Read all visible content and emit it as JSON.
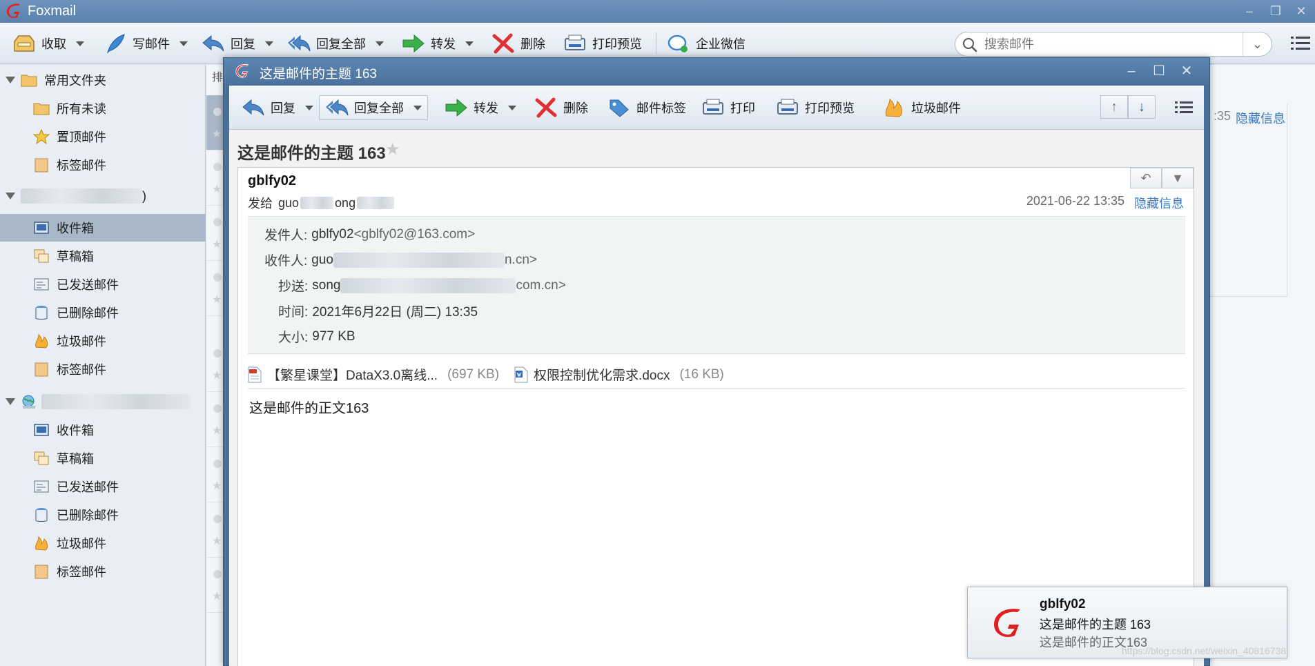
{
  "app": {
    "title": "Foxmail"
  },
  "toolbar": {
    "receive": "收取",
    "compose": "写邮件",
    "reply": "回复",
    "reply_all": "回复全部",
    "forward": "转发",
    "delete": "删除",
    "print_preview": "打印预览",
    "wecom": "企业微信",
    "search_placeholder": "搜索邮件"
  },
  "sidebar": {
    "common_folders": "常用文件夹",
    "common_items": [
      "所有未读",
      "置顶邮件",
      "标签邮件"
    ],
    "account1_suffix": ")",
    "account1_items": [
      "收件箱",
      "草稿箱",
      "已发送邮件",
      "已删除邮件",
      "垃圾邮件",
      "标签邮件"
    ],
    "account2_items": [
      "收件箱",
      "草稿箱",
      "已发送邮件",
      "已删除邮件",
      "垃圾邮件",
      "标签邮件"
    ]
  },
  "maillist": {
    "sort_label": "排"
  },
  "rightpane": {
    "time_fragment": ":35",
    "hide_info": "隐藏信息"
  },
  "message_window": {
    "title": "这是邮件的主题 163",
    "toolbar": {
      "reply": "回复",
      "reply_all": "回复全部",
      "forward": "转发",
      "delete": "删除",
      "tag": "邮件标签",
      "print": "打印",
      "print_preview": "打印预览",
      "junk": "垃圾邮件"
    },
    "subject": "这是邮件的主题 163",
    "sender": "gblfy02",
    "send_to_label": "发给",
    "send_to_a": "guo",
    "send_to_b": "ong",
    "datetime": "2021-06-22 13:35",
    "hide_info": "隐藏信息",
    "details": {
      "from_label": "发件人:",
      "from_name": "gblfy02",
      "from_addr": "<gblfy02@163.com>",
      "to_label": "收件人:",
      "to_prefix": "guo",
      "to_suffix": "n.cn>",
      "cc_label": "抄送:",
      "cc_prefix": "song",
      "cc_suffix": "com.cn>",
      "time_label": "时间:",
      "time_value": "2021年6月22日 (周二) 13:35",
      "size_label": "大小:",
      "size_value": "977 KB"
    },
    "attachments": [
      {
        "name": "【繁星课堂】DataX3.0离线...",
        "size": "(697 KB)"
      },
      {
        "name": "权限控制优化需求.docx",
        "size": "(16 KB)"
      }
    ],
    "body": "这是邮件的正文163"
  },
  "notification": {
    "sender": "gblfy02",
    "subject": "这是邮件的主题 163",
    "preview": "这是邮件的正文163"
  },
  "watermark": "https://blog.csdn.net/weixin_40816738",
  "colors": {
    "accent": "#3a7bc4",
    "titlebar": "#5a82ae",
    "brand_red": "#e02020"
  }
}
